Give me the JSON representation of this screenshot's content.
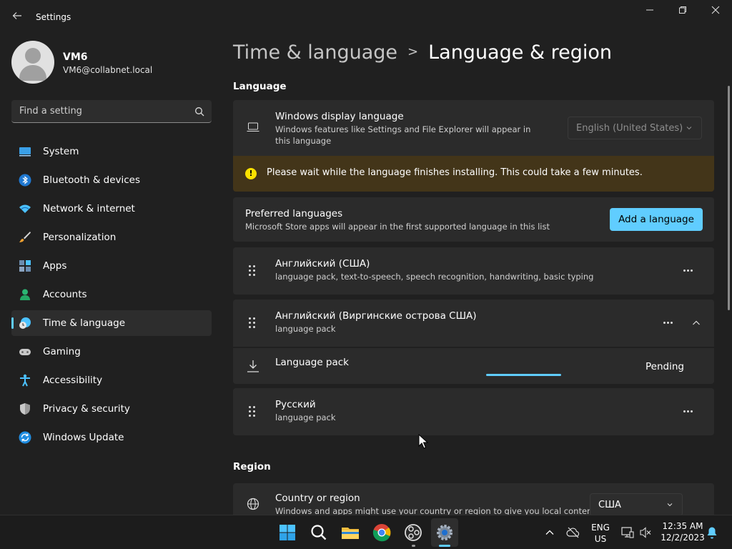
{
  "window": {
    "title": "Settings",
    "back_icon": "back-arrow-icon",
    "controls": [
      "minimize-icon",
      "maximize-icon",
      "close-icon"
    ]
  },
  "profile": {
    "name": "VM6",
    "email": "VM6@collabnet.local"
  },
  "search": {
    "placeholder": "Find a setting"
  },
  "sidebar": {
    "items": [
      {
        "label": "System",
        "icon": "system-icon",
        "active": false
      },
      {
        "label": "Bluetooth & devices",
        "icon": "bluetooth-icon",
        "active": false
      },
      {
        "label": "Network & internet",
        "icon": "wifi-icon",
        "active": false
      },
      {
        "label": "Personalization",
        "icon": "brush-icon",
        "active": false
      },
      {
        "label": "Apps",
        "icon": "apps-icon",
        "active": false
      },
      {
        "label": "Accounts",
        "icon": "accounts-icon",
        "active": false
      },
      {
        "label": "Time & language",
        "icon": "time-language-icon",
        "active": true
      },
      {
        "label": "Gaming",
        "icon": "gamepad-icon",
        "active": false
      },
      {
        "label": "Accessibility",
        "icon": "accessibility-icon",
        "active": false
      },
      {
        "label": "Privacy & security",
        "icon": "shield-icon",
        "active": false
      },
      {
        "label": "Windows Update",
        "icon": "update-icon",
        "active": false
      }
    ]
  },
  "breadcrumb": {
    "parent": "Time & language",
    "separator": ">",
    "current": "Language & region"
  },
  "language_section": {
    "heading": "Language",
    "display_language": {
      "title": "Windows display language",
      "description": "Windows features like Settings and File Explorer will appear in this language",
      "value": "English (United States)"
    },
    "warning": "Please wait while the language finishes installing. This could take a few minutes.",
    "preferred": {
      "title": "Preferred languages",
      "description": "Microsoft Store apps will appear in the first supported language in this list",
      "add_button": "Add a language"
    },
    "languages": [
      {
        "name": "Английский (США)",
        "features": "language pack, text-to-speech, speech recognition, handwriting, basic typing"
      },
      {
        "name": "Английский (Виргинские острова США)",
        "features": "language pack"
      },
      {
        "name": "Русский",
        "features": "language pack"
      }
    ],
    "pack_row": {
      "title": "Language pack",
      "status": "Pending"
    }
  },
  "region_section": {
    "heading": "Region",
    "country": {
      "title": "Country or region",
      "description": "Windows and apps might use your country or region to give you local content",
      "value": "США"
    }
  },
  "taskbar": {
    "apps": [
      "start-icon",
      "search-icon",
      "file-explorer-icon",
      "chrome-icon",
      "obs-icon",
      "settings-icon"
    ],
    "lang_top": "ENG",
    "lang_bottom": "US",
    "time": "12:35 AM",
    "date": "12/2/2023"
  },
  "colors": {
    "accent": "#60cdff",
    "warning_bg": "#433519",
    "warning_icon": "#fce100",
    "background": "#202020",
    "card": "#2b2b2b"
  }
}
